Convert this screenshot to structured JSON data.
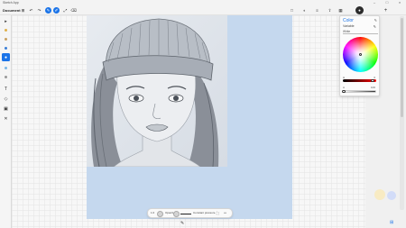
{
  "titlebar": {
    "app_title": "Sketch App",
    "minimize": "–",
    "maximize": "□",
    "close": "×"
  },
  "commandbar": {
    "document_title": "Document",
    "left_icons": [
      "grid-icon",
      "undo-icon",
      "redo-icon",
      "brush-icon",
      "pen-icon",
      "selection-icon",
      "eraser-icon"
    ],
    "right_icons": [
      "square-icon",
      "adjust-icon",
      "layers-icon",
      "share-icon",
      "color-icon",
      "settings-icon"
    ],
    "active_color": "#1a73e8"
  },
  "tools": {
    "items": [
      {
        "name": "select",
        "glyph": "▸",
        "active": false
      },
      {
        "name": "pencil-yellow",
        "glyph": "✎",
        "active": false
      },
      {
        "name": "marker-blue",
        "glyph": "✎",
        "active": false
      },
      {
        "name": "brush-blue",
        "glyph": "●",
        "active": true
      },
      {
        "name": "pen-light",
        "glyph": "✎",
        "active": false
      },
      {
        "name": "text",
        "glyph": "T",
        "active": false
      },
      {
        "name": "shape",
        "glyph": "◇",
        "active": false
      },
      {
        "name": "fill",
        "glyph": "▣",
        "active": false
      },
      {
        "name": "eyedropper",
        "glyph": "✕",
        "active": false
      }
    ]
  },
  "color_panel": {
    "title": "Color",
    "mode": "Variable",
    "hex_label": "White",
    "hue_label": "H",
    "hue_value": "0",
    "alpha_label": "A",
    "alpha_value": "100"
  },
  "brushbar": {
    "size_label": "1.0",
    "opacity_label": "Opacity",
    "mode_label": "Constant pressure",
    "more": "•••"
  }
}
